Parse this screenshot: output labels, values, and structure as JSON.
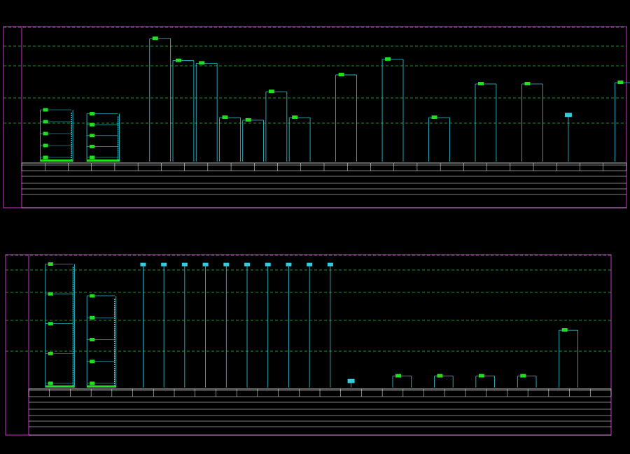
{
  "colors": {
    "background": "#000000",
    "frame": "#cc33cc",
    "dash": "#22cc33",
    "riser": "#33ccdd",
    "device": "#22dd22",
    "device_alt": "#33ccdd",
    "table": "#ffffff",
    "note": "#ff3030",
    "text": "#ffffff"
  },
  "bottom_caption": "",
  "panels": [
    {
      "id": "panel-1",
      "notes": [
        "",
        ""
      ],
      "title": "",
      "columns": 26,
      "risers": [
        {
          "col": 1,
          "top": 0.6,
          "kind": "group"
        },
        {
          "col": 3,
          "top": 0.63,
          "kind": "group"
        },
        {
          "col": 5,
          "top": 0.05,
          "kind": "line"
        },
        {
          "col": 6,
          "top": 0.22,
          "kind": "line"
        },
        {
          "col": 7,
          "top": 0.24,
          "kind": "line"
        },
        {
          "col": 8,
          "top": 0.66,
          "kind": "line"
        },
        {
          "col": 9,
          "top": 0.68,
          "kind": "line"
        },
        {
          "col": 10,
          "top": 0.46,
          "kind": "line"
        },
        {
          "col": 11,
          "top": 0.66,
          "kind": "line"
        },
        {
          "col": 13,
          "top": 0.33,
          "kind": "line"
        },
        {
          "col": 15,
          "top": 0.21,
          "kind": "line"
        },
        {
          "col": 17,
          "top": 0.66,
          "kind": "line"
        },
        {
          "col": 19,
          "top": 0.4,
          "kind": "line"
        },
        {
          "col": 21,
          "top": 0.4,
          "kind": "line"
        },
        {
          "col": 23,
          "top": 0.65,
          "kind": "box"
        },
        {
          "col": 25,
          "top": 0.39,
          "kind": "line"
        }
      ]
    },
    {
      "id": "panel-2",
      "notes": [
        "",
        ""
      ],
      "title": "",
      "columns": 28,
      "risers": [
        {
          "col": 1,
          "top": 0.03,
          "kind": "group"
        },
        {
          "col": 3,
          "top": 0.28,
          "kind": "group"
        },
        {
          "col": 5,
          "top": 0.02,
          "kind": "tag"
        },
        {
          "col": 6,
          "top": 0.02,
          "kind": "tag"
        },
        {
          "col": 7,
          "top": 0.02,
          "kind": "tag"
        },
        {
          "col": 8,
          "top": 0.02,
          "kind": "tag"
        },
        {
          "col": 9,
          "top": 0.02,
          "kind": "tag"
        },
        {
          "col": 10,
          "top": 0.02,
          "kind": "tag"
        },
        {
          "col": 11,
          "top": 0.02,
          "kind": "tag"
        },
        {
          "col": 12,
          "top": 0.02,
          "kind": "tag"
        },
        {
          "col": 13,
          "top": 0.02,
          "kind": "tag"
        },
        {
          "col": 14,
          "top": 0.02,
          "kind": "tag"
        },
        {
          "col": 15,
          "top": 0.96,
          "kind": "box"
        },
        {
          "col": 17,
          "top": 0.91,
          "kind": "line"
        },
        {
          "col": 19,
          "top": 0.91,
          "kind": "line"
        },
        {
          "col": 21,
          "top": 0.91,
          "kind": "line"
        },
        {
          "col": 23,
          "top": 0.91,
          "kind": "line"
        },
        {
          "col": 25,
          "top": 0.55,
          "kind": "line"
        }
      ]
    }
  ]
}
